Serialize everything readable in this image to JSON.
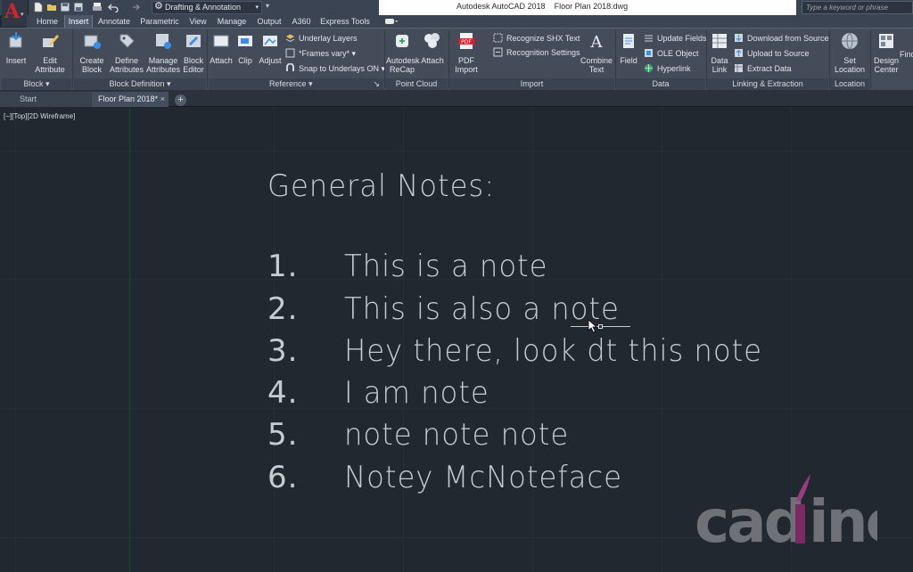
{
  "titlebar": {
    "workspace": "Drafting & Annotation",
    "app_title": "Autodesk AutoCAD 2018    Floor Plan 2018.dwg",
    "search_placeholder": "Type a keyword or phrase"
  },
  "ribbon_tabs": [
    "Home",
    "Insert",
    "Annotate",
    "Parametric",
    "View",
    "Manage",
    "Output",
    "A360",
    "Express Tools"
  ],
  "active_tab": "Insert",
  "ribbon": {
    "block": {
      "title": "Block",
      "insert": "Insert",
      "edit_attribute": "Edit\nAttribute"
    },
    "block_definition": {
      "title": "Block Definition",
      "create_block": "Create\nBlock",
      "define_attributes": "Define\nAttributes",
      "manage_attributes": "Manage\nAttributes",
      "block_editor": "Block\nEditor"
    },
    "reference": {
      "title": "Reference",
      "attach": "Attach",
      "clip": "Clip",
      "adjust": "Adjust",
      "underlay_layers": "Underlay Layers",
      "frames_vary": "*Frames vary*",
      "snap_to_underlays": "Snap to Underlays ON"
    },
    "point_cloud": {
      "title": "Point Cloud",
      "recap": "Autodesk\nReCap",
      "attach": "Attach"
    },
    "import": {
      "title": "Import",
      "pdf_import": "PDF\nImport",
      "recognize_shx": "Recognize SHX Text",
      "recognition_settings": "Recognition Settings",
      "combine_text": "Combine\nText"
    },
    "data": {
      "title": "Data",
      "field": "Field",
      "update_fields": "Update Fields",
      "ole_object": "OLE Object",
      "hyperlink": "Hyperlink"
    },
    "linking": {
      "title": "Linking & Extraction",
      "data_link": "Data\nLink",
      "download_from_source": "Download from Source",
      "upload_to_source": "Upload to Source",
      "extract_data": "Extract  Data"
    },
    "location": {
      "title": "Location",
      "set_location": "Set\nLocation"
    },
    "content": {
      "design_center": "Design\nCenter",
      "find": "Find"
    }
  },
  "doc_tabs": {
    "start": "Start",
    "floor_plan": "Floor Plan 2018*",
    "close": "×",
    "new": "+"
  },
  "viewport_label": "[−][Top][2D Wireframe]",
  "drawing": {
    "heading": "General Notes:",
    "notes": [
      {
        "num": "1.",
        "text": "This is a note"
      },
      {
        "num": "2.",
        "text": "This is also a note"
      },
      {
        "num": "3.",
        "text": "Hey there, look dt this note"
      },
      {
        "num": "4.",
        "text": "I am note"
      },
      {
        "num": "5.",
        "text": "note note note"
      },
      {
        "num": "6.",
        "text": "Notey McNoteface"
      }
    ]
  },
  "watermark": "cadline",
  "colors": {
    "canvas": "#212830",
    "ribbon": "#444c5a",
    "text": "#c5cbd1",
    "brand_red": "#d1242f",
    "logo_purple": "#8a2a6c"
  }
}
